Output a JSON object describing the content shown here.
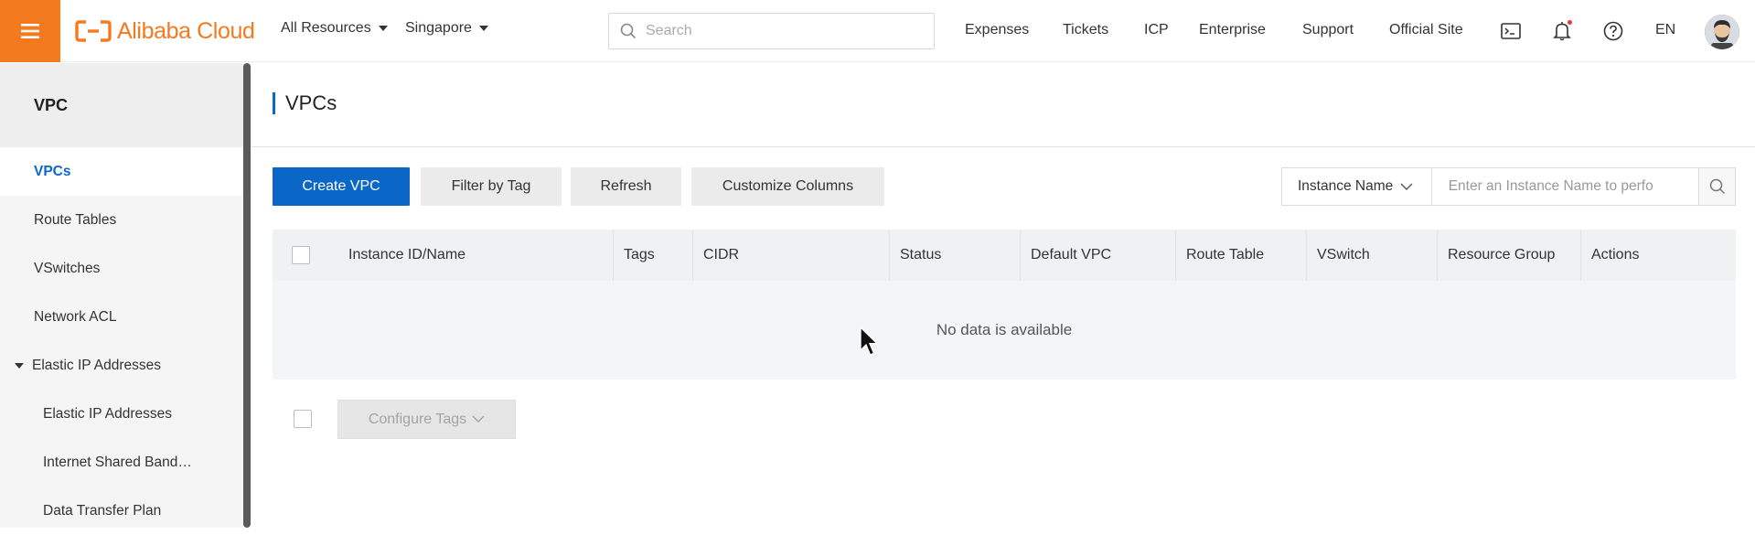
{
  "topbar": {
    "logo_text": "Alibaba Cloud",
    "resources_label": "All Resources",
    "region_label": "Singapore",
    "search_placeholder": "Search",
    "nav": [
      "Expenses",
      "Tickets",
      "ICP",
      "Enterprise",
      "Support",
      "Official Site"
    ],
    "lang": "EN",
    "icons": [
      "menu-icon",
      "terminal-icon",
      "bell-icon",
      "help-icon",
      "avatar"
    ]
  },
  "sidebar": {
    "title": "VPC",
    "items": [
      {
        "label": "VPCs",
        "active": true
      },
      {
        "label": "Route Tables"
      },
      {
        "label": "VSwitches"
      },
      {
        "label": "Network ACL"
      },
      {
        "label": "Elastic IP Addresses",
        "expanded": true
      },
      {
        "label": "Elastic IP Addresses",
        "sub": true
      },
      {
        "label": "Internet Shared Band…",
        "sub": true
      },
      {
        "label": "Data Transfer Plan",
        "sub": true
      }
    ]
  },
  "main": {
    "title": "VPCs",
    "buttons": {
      "create": "Create VPC",
      "filter_by_tag": "Filter by Tag",
      "refresh": "Refresh",
      "customize_columns": "Customize Columns"
    },
    "filter": {
      "select_label": "Instance Name",
      "input_placeholder": "Enter an Instance Name to perfo"
    },
    "table": {
      "columns": [
        "Instance ID/Name",
        "Tags",
        "CIDR",
        "Status",
        "Default VPC",
        "Route Table",
        "VSwitch",
        "Resource Group",
        "Actions"
      ],
      "empty_text": "No data is available"
    },
    "configure_tags": "Configure Tags"
  },
  "colors": {
    "brand_orange": "#f47a20",
    "primary_blue": "#0a67c8"
  }
}
